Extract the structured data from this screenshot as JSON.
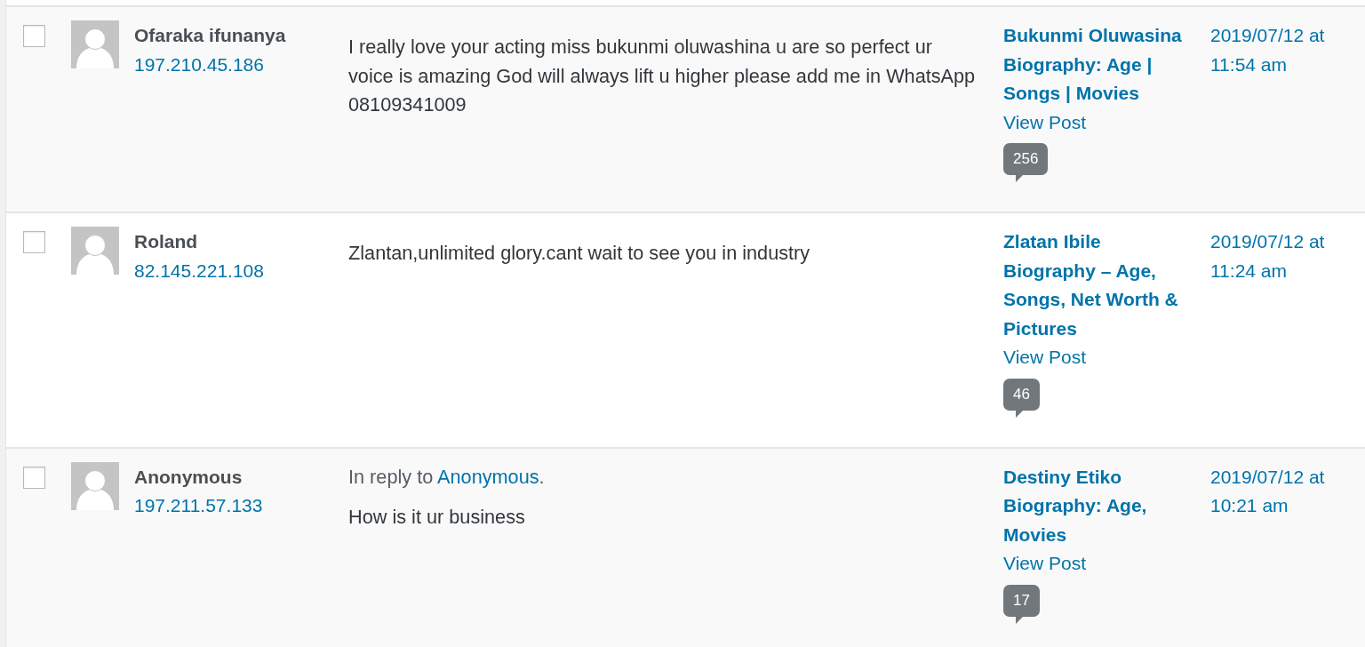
{
  "comments": [
    {
      "selected": false,
      "author": "Ofaraka ifunanya",
      "ip": "197.210.45.186",
      "text": "I really love your acting miss bukunmi oluwashina u are so perfect ur voice is amazing God will always lift u higher please add me in WhatsApp 08109341009",
      "post_title": "Bukunmi Oluwasina Biography: Age | Songs | Movies",
      "view_post": "View Post",
      "comment_count": "256",
      "date": "2019/07/12 at 11:54 am"
    },
    {
      "selected": false,
      "author": "Roland",
      "ip": "82.145.221.108",
      "text": "Zlantan,unlimited glory.cant wait to see you in industry",
      "post_title": "Zlatan Ibile Biography – Age, Songs, Net Worth & Pictures",
      "view_post": "View Post",
      "comment_count": "46",
      "date": "2019/07/12 at 11:24 am"
    },
    {
      "selected": false,
      "author": "Anonymous",
      "ip": "197.211.57.133",
      "in_reply_to": {
        "prefix": "In reply to",
        "author": "Anonymous",
        "suffix": "."
      },
      "text": "How is it ur business",
      "post_title": "Destiny Etiko Biography: Age, Movies",
      "view_post": "View Post",
      "comment_count": "17",
      "date": "2019/07/12 at 10:21 am"
    }
  ]
}
